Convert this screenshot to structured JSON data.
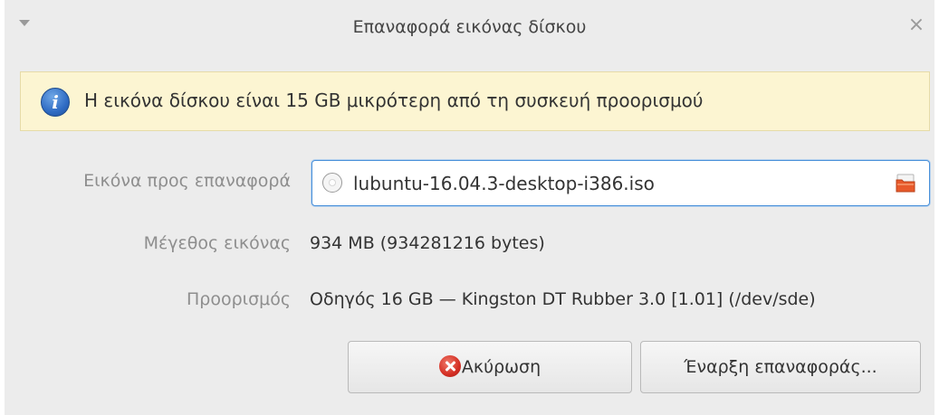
{
  "window": {
    "title": "Επαναφορά εικόνας δίσκου",
    "close_glyph": "×"
  },
  "info": {
    "icon": "info-icon",
    "icon_glyph": "i",
    "message": "Η εικόνα δίσκου είναι 15 GB μικρότερη από τη συσκευή προορισμού"
  },
  "form": {
    "image_label": "Εικόνα προς επαναφορά",
    "image_file": "lubuntu-16.04.3-desktop-i386.iso",
    "size_label": "Μέγεθος εικόνας",
    "size_value": "934 MB (934281216 bytes)",
    "destination_label": "Προορισμός",
    "destination_value": "Οδηγός 16 GB — Kingston DT Rubber 3.0 [1.01] (/dev/sde)"
  },
  "buttons": {
    "cancel_label": "Ακύρωση",
    "restore_label": "Έναρξη επαναφοράς..."
  },
  "colors": {
    "accent": "#4a90d9",
    "info_background": "#fcf5d2",
    "cancel_icon": "#d42f24"
  }
}
